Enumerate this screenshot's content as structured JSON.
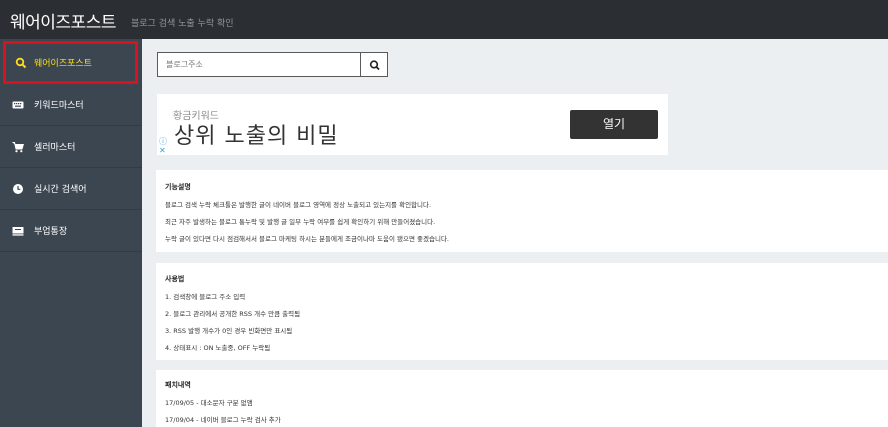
{
  "header": {
    "brand": "웨어이즈포스트",
    "subtitle": "블로그 검색 노출 누락 확인"
  },
  "sidebar": {
    "items": [
      {
        "label": "웨어이즈포스트",
        "icon": "search-icon"
      },
      {
        "label": "키워드마스터",
        "icon": "keyboard-icon"
      },
      {
        "label": "셀러마스터",
        "icon": "cart-icon"
      },
      {
        "label": "실시간 검색어",
        "icon": "clock-icon"
      },
      {
        "label": "부업통장",
        "icon": "bankbook-icon"
      }
    ]
  },
  "search": {
    "placeholder": "블로그주소",
    "button_icon": "search-icon"
  },
  "ad": {
    "small_text": "황금키워드",
    "headline": "상위 노출의 비밀",
    "button_label": "열기",
    "info_glyph": "ⓘ",
    "close_glyph": "✕"
  },
  "sections": {
    "features": {
      "title": "기능설명",
      "lines": [
        "블로그 검색 누락 체크툴은 발행한 글이 네이버 블로그 영역에 정상 노출되고 있는지를 확인합니다.",
        "최근 자주 발생하는 블로그 통누락 및 발행 글 일부 누락 여부를 쉽게 확인하기 위해 만들어졌습니다.",
        "누락 글이 있다면 다시 점검해서서 블로그 마케팅 하시는 분들에게 조금이나마 도움이 됐으면 좋겠습니다."
      ]
    },
    "usage": {
      "title": "사용법",
      "lines": [
        "1. 검색창에 블로그 주소 입력",
        "2. 블로그 관리에서 공개한 RSS 개수 만큼 출력됨",
        "3. RSS 발행 개수가 0인 경우 빈화면만 표시됨",
        "4. 상태표시 : ON 노출중, OFF 누락됨"
      ]
    },
    "patch": {
      "title": "패치내역",
      "lines": [
        "17/09/05 - 대소문자 구분 없앰",
        "17/09/04 - 네이버 블로그 누락 검사 추가"
      ]
    }
  }
}
